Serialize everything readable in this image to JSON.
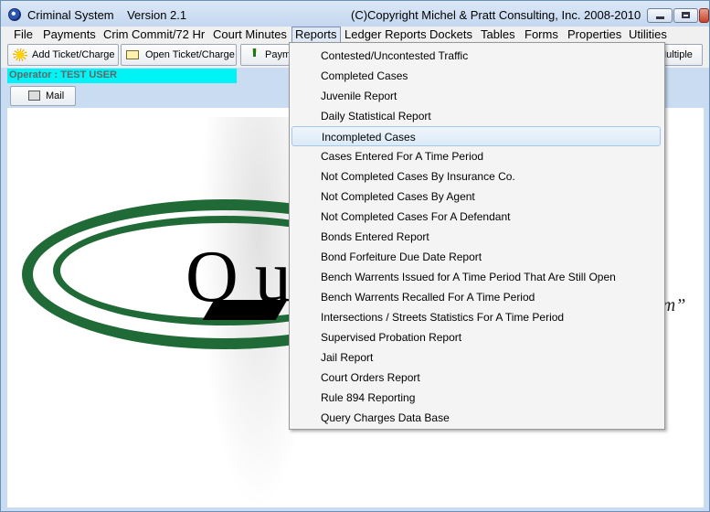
{
  "window": {
    "title": "Criminal System",
    "version": "Version 2.1",
    "copyright": "(C)Copyright  Michel & Pratt Consulting, Inc. 2008-2010"
  },
  "menubar": {
    "items": [
      "File",
      "Payments",
      "Crim Commit/72 Hr",
      "Court Minutes",
      "Reports",
      "Ledger Reports",
      "Dockets",
      "Tables",
      "Forms",
      "Properties",
      "Utilities"
    ],
    "active": "Reports"
  },
  "toolbar": {
    "add_ticket": "Add Ticket/Charge",
    "open_ticket": "Open Ticket/Charge",
    "payments": "Paym",
    "multiple": "Multiple"
  },
  "operator": {
    "label": "Operator : TEST USER"
  },
  "mail": {
    "label": "Mail"
  },
  "background": {
    "slogan_fragment": "rm”"
  },
  "reports_menu": {
    "items": [
      "Contested/Uncontested Traffic",
      "Completed Cases",
      "Juvenile Report",
      "Daily Statistical Report",
      "Incompleted Cases",
      "Cases Entered For A Time Period",
      "Not Completed Cases By Insurance Co.",
      "Not Completed Cases By Agent",
      "Not Completed Cases For A Defendant",
      "Bonds Entered Report",
      "Bond Forfeiture Due Date Report",
      "Bench Warrents Issued for A Time Period That Are Still Open",
      "Bench Warrents Recalled For A Time Period",
      "Intersections / Streets Statistics For A Time Period",
      "Supervised Probation Report",
      "Jail Report",
      "Court Orders Report",
      "Rule 894 Reporting",
      "Query Charges Data Base"
    ],
    "highlighted": "Incompleted Cases"
  }
}
